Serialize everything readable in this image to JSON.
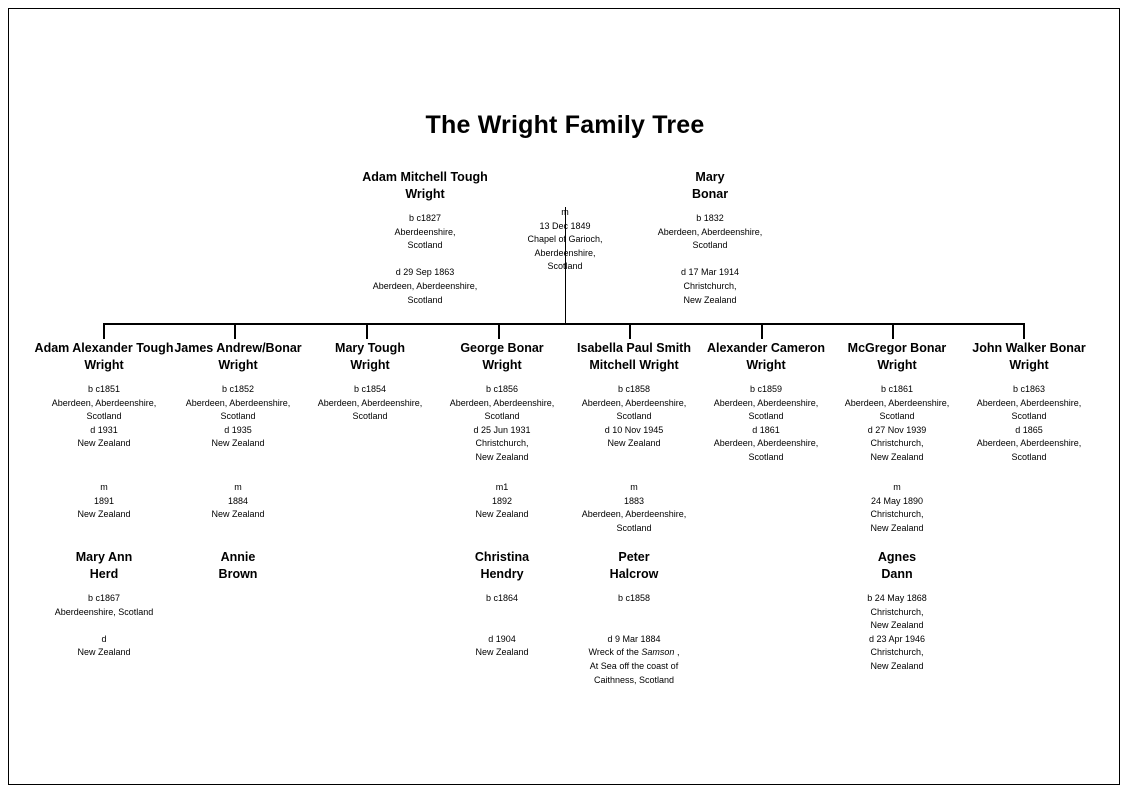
{
  "document": {
    "title": "The Wright Family Tree"
  },
  "parents": {
    "father": {
      "name_line1": "Adam Mitchell Tough",
      "name_line2": "Wright",
      "birth": [
        "b c1827",
        "Aberdeenshire,",
        "Scotland"
      ],
      "death": [
        "d 29 Sep 1863",
        "Aberdeen, Aberdeenshire,",
        "Scotland"
      ]
    },
    "marriage": {
      "marker": "m",
      "lines": [
        "13 Dec 1849",
        "Chapel of Garioch,",
        "Aberdeenshire,",
        "Scotland"
      ]
    },
    "mother": {
      "name_line1": "Mary",
      "name_line2": "Bonar",
      "birth": [
        "b 1832",
        "Aberdeen, Aberdeenshire,",
        "Scotland"
      ],
      "death": [
        "d 17 Mar 1914",
        "Christchurch,",
        "New Zealand"
      ]
    }
  },
  "children": [
    {
      "name_line1": "Adam Alexander Tough",
      "name_line2": "Wright",
      "birth": [
        "b c1851",
        "Aberdeen, Aberdeenshire,",
        "Scotland"
      ],
      "death": [
        "d 1931",
        "New Zealand"
      ],
      "marriage": {
        "marker": "m",
        "lines": [
          "1891",
          "New Zealand"
        ]
      },
      "spouse": {
        "name_line1": "Mary Ann",
        "name_line2": "Herd",
        "birth": [
          "b c1867",
          "Aberdeenshire, Scotland"
        ],
        "death": [
          "d",
          "New Zealand"
        ]
      }
    },
    {
      "name_line1": "James Andrew/Bonar",
      "name_line2": "Wright",
      "birth": [
        "b c1852",
        "Aberdeen, Aberdeenshire,",
        "Scotland"
      ],
      "death": [
        "d 1935",
        "New Zealand"
      ],
      "marriage": {
        "marker": "m",
        "lines": [
          "1884",
          "New Zealand"
        ]
      },
      "spouse": {
        "name_line1": "Annie",
        "name_line2": "Brown",
        "birth": [],
        "death": []
      }
    },
    {
      "name_line1": "Mary Tough",
      "name_line2": "Wright",
      "birth": [
        "b c1854",
        "Aberdeen, Aberdeenshire,",
        "Scotland"
      ],
      "death": [],
      "marriage": null,
      "spouse": null
    },
    {
      "name_line1": "George Bonar",
      "name_line2": "Wright",
      "birth": [
        "b c1856",
        "Aberdeen, Aberdeenshire,",
        "Scotland"
      ],
      "death": [
        "d 25 Jun 1931",
        "Christchurch,",
        "New Zealand"
      ],
      "marriage": {
        "marker": "m1",
        "lines": [
          "1892",
          "New Zealand"
        ]
      },
      "spouse": {
        "name_line1": "Christina",
        "name_line2": "Hendry",
        "birth": [
          "b c1864"
        ],
        "death": [
          "d 1904",
          "New Zealand"
        ]
      }
    },
    {
      "name_line1": "Isabella Paul Smith",
      "name_line2": "Mitchell Wright",
      "birth": [
        "b c1858",
        "Aberdeen, Aberdeenshire,",
        "Scotland"
      ],
      "death": [
        "d 10 Nov 1945",
        "New Zealand"
      ],
      "marriage": {
        "marker": "m",
        "lines": [
          "1883",
          "Aberdeen, Aberdeenshire,",
          "Scotland"
        ]
      },
      "spouse": {
        "name_line1": "Peter",
        "name_line2": "Halcrow",
        "birth": [
          "b c1858"
        ],
        "death_line1": "d 9 Mar 1884",
        "death_ship_prefix": "Wreck of the ",
        "death_ship_name": "Samson",
        "death_ship_suffix": " ,",
        "death_line3": "At Sea off the coast of",
        "death_line4": "Caithness, Scotland"
      }
    },
    {
      "name_line1": "Alexander Cameron",
      "name_line2": "Wright",
      "birth": [
        "b c1859",
        "Aberdeen, Aberdeenshire,",
        "Scotland"
      ],
      "death": [
        "d 1861",
        "Aberdeen, Aberdeenshire,",
        "Scotland"
      ],
      "marriage": null,
      "spouse": null
    },
    {
      "name_line1": "McGregor Bonar",
      "name_line2": "Wright",
      "birth": [
        "b c1861",
        "Aberdeen, Aberdeenshire,",
        "Scotland"
      ],
      "death": [
        "d 27 Nov 1939",
        "Christchurch,",
        "New Zealand"
      ],
      "marriage": {
        "marker": "m",
        "lines": [
          "24 May 1890",
          "Christchurch,",
          "New Zealand"
        ]
      },
      "spouse": {
        "name_line1": "Agnes",
        "name_line2": "Dann",
        "birth": [
          "b 24 May 1868",
          "Christchurch,",
          "New Zealand"
        ],
        "death": [
          "d 23 Apr 1946",
          "Christchurch,",
          "New Zealand"
        ]
      }
    },
    {
      "name_line1": "John Walker Bonar",
      "name_line2": "Wright",
      "birth": [
        "b c1863",
        "Aberdeen, Aberdeenshire,",
        "Scotland"
      ],
      "death": [
        "d 1865",
        "Aberdeen, Aberdeenshire,",
        "Scotland"
      ],
      "marriage": null,
      "spouse": null
    }
  ],
  "colors": {
    "ink": "#000000",
    "paper": "#ffffff",
    "border": "#000000"
  }
}
